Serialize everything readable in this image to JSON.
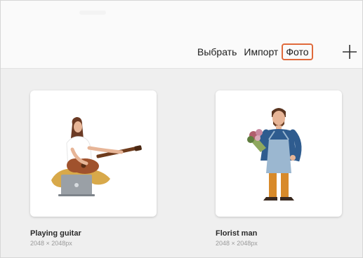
{
  "toolbar": {
    "select_label": "Выбрать",
    "import_label": "Импорт",
    "photos_label": "Фото",
    "add_icon": "plus-icon",
    "highlight_color": "#e06a3b"
  },
  "documents": [
    {
      "title": "Playing guitar",
      "size": "2048 × 2048px",
      "thumbnail_icon": "guitar-player-illustration"
    },
    {
      "title": "Florist man",
      "size": "2048 × 2048px",
      "thumbnail_icon": "florist-man-illustration"
    }
  ]
}
